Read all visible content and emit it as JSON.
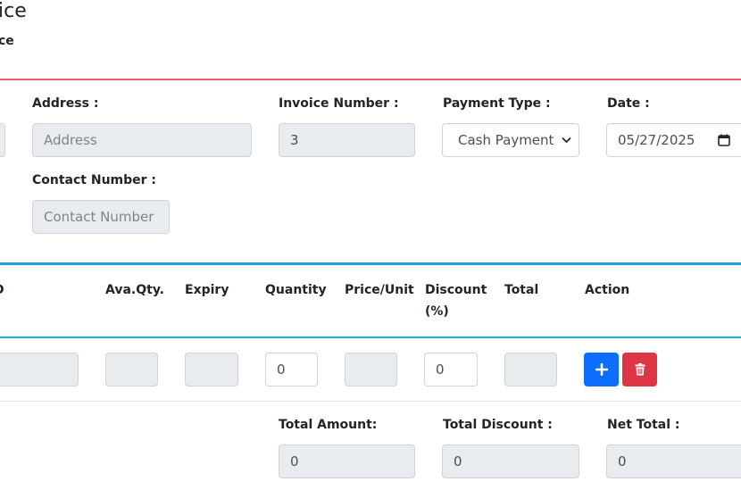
{
  "header": {
    "title": "ice",
    "subtitle": "ce"
  },
  "form": {
    "address_label": "Address :",
    "address_placeholder": "Address",
    "invoice_number_label": "Invoice Number :",
    "invoice_number_value": "3",
    "payment_type_label": "Payment Type :",
    "payment_type_value": "Cash Payment",
    "date_label": "Date :",
    "date_value": "05/27/2025",
    "contact_label": "Contact Number :",
    "contact_placeholder": "Contact Number"
  },
  "table": {
    "headers": {
      "partial": "D",
      "ava_qty": "Ava.Qty.",
      "expiry": "Expiry",
      "quantity": "Quantity",
      "price_unit": "Price/Unit",
      "discount_line1": "Discount",
      "discount_line2": "(%)",
      "total": "Total",
      "action": "Action"
    },
    "row": {
      "quantity": "0",
      "discount": "0"
    }
  },
  "totals": {
    "total_amount_label": "Total Amount:",
    "total_amount_value": "0",
    "total_discount_label": "Total Discount :",
    "total_discount_value": "0",
    "net_total_label": "Net Total :",
    "net_total_value": "0"
  },
  "colors": {
    "add_button": "#0d6efd",
    "delete_button": "#dc3545",
    "red_divider": "#e4606d",
    "blue_divider": "#17a2d8"
  },
  "icons": {
    "add": "plus-icon",
    "delete": "trash-icon",
    "date": "calendar-icon",
    "select": "chevron-down-icon"
  }
}
